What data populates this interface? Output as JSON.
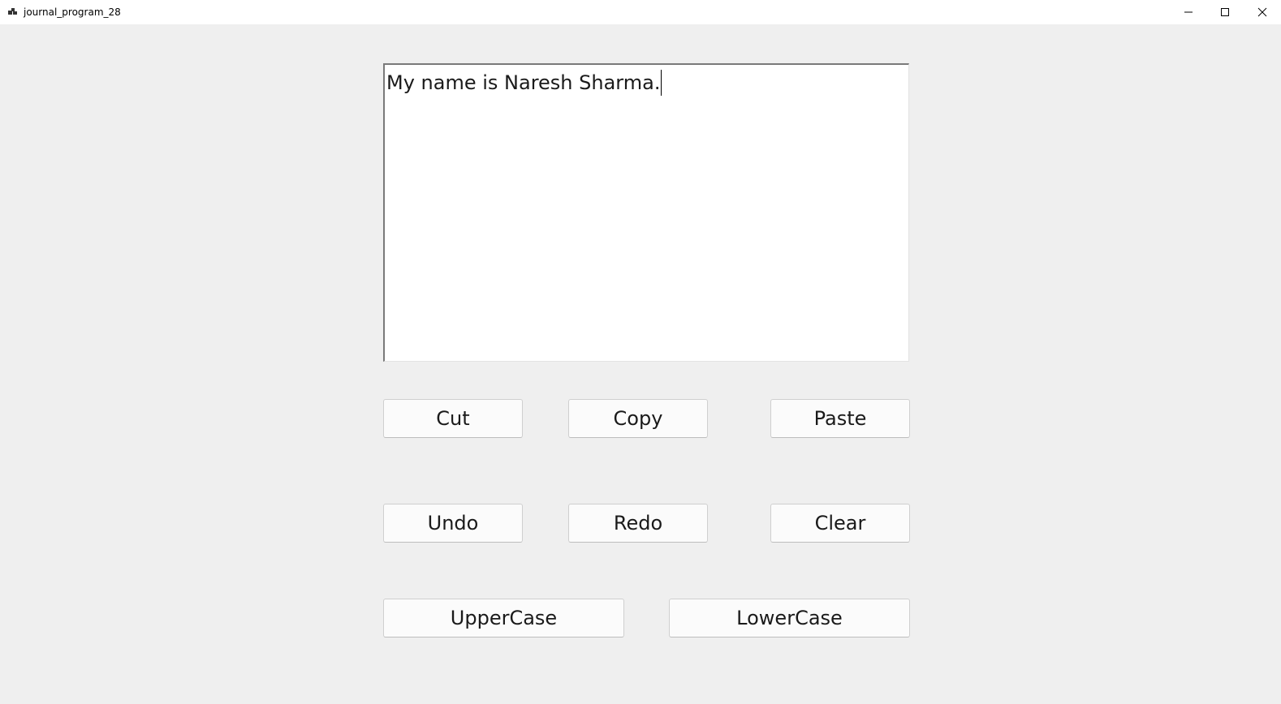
{
  "window": {
    "title": "journal_program_28"
  },
  "editor": {
    "text": "My name is Naresh Sharma."
  },
  "buttons": {
    "cut": "Cut",
    "copy": "Copy",
    "paste": "Paste",
    "undo": "Undo",
    "redo": "Redo",
    "clear": "Clear",
    "uppercase": "UpperCase",
    "lowercase": "LowerCase"
  },
  "icons": {
    "app": "app-icon",
    "minimize": "minimize-icon",
    "maximize": "maximize-icon",
    "close": "close-icon"
  }
}
